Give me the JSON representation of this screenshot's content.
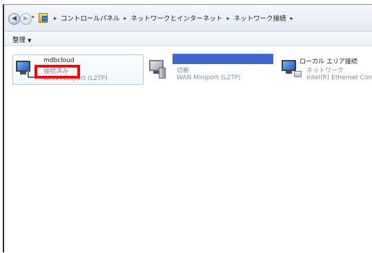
{
  "window": {
    "breadcrumb": [
      "コントロールパネル",
      "ネットワークとインターネット",
      "ネットワーク接続"
    ]
  },
  "toolbar": {
    "organize_label": "整理"
  },
  "connections": [
    {
      "name": "mdbcloud",
      "status": "接続済み",
      "device": "WAN Miniport (L2TP)",
      "selected": true
    },
    {
      "name": "",
      "status": "切断",
      "device": "WAN Miniport (L2TP)",
      "selected": false
    },
    {
      "name": "ローカル エリア接続",
      "status": "ネットワーク",
      "device": "Intel(R) Ethernet Conn",
      "selected": false
    }
  ],
  "colors": {
    "highlight": "#ff0000",
    "redaction": "#3f67c9",
    "selection_border": "#aec8de"
  },
  "icons": [
    "back-arrow-icon",
    "forward-arrow-icon",
    "control-panel-icon",
    "network-connection-icon"
  ]
}
